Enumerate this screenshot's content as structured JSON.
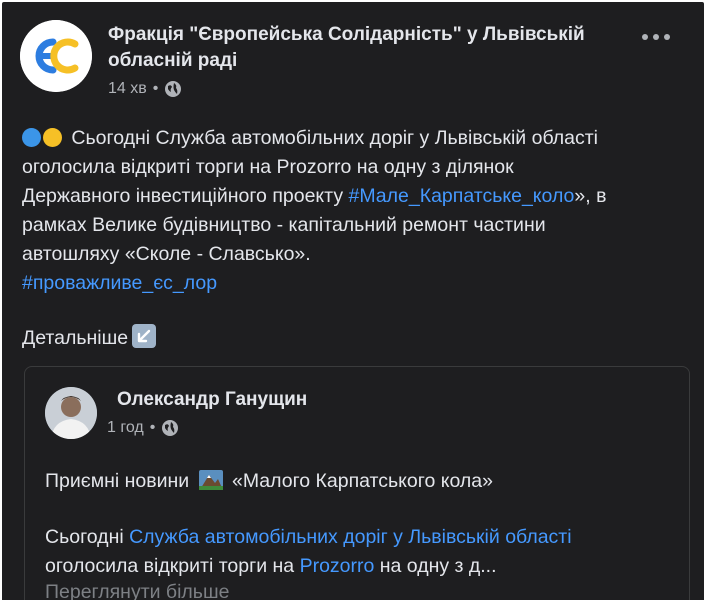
{
  "post": {
    "author": "Фракція \"Європейська Солідарність\" у Львівській обласній раді",
    "time": "14 хв",
    "separator": "•",
    "privacy_icon": "globe-icon",
    "more_icon": "more-options-icon",
    "logo_text": "ЄС",
    "text_line1": " Сьогодні Служба автомобільних доріг у Львівській області",
    "text_line2": "оголосила відкриті торги на Prozorro на одну з ділянок",
    "text_line3_a": "Державного інвестиційного проекту ",
    "hashtag_1": "#Мале_Карпатське_коло",
    "text_line3_b": "», в",
    "text_line4": "рамках Велике будівництво  - капітальний ремонт частини",
    "text_line5": "автошляху «Сколе - Славсько».",
    "hashtag_2": "#проважливе_єс_лор",
    "details_label": "Детальніше",
    "details_icon": "arrow-down-left-icon"
  },
  "shared": {
    "author": "Олександр Ганущин",
    "time": "1 год",
    "separator": "•",
    "line1_a": "Приємні новини ",
    "line1_b": " «Малого Карпатського кола»",
    "para_a": "Сьогодні ",
    "link_1": "Служба автомобільних доріг у Львівській області",
    "para_b": "оголосила відкриті торги на ",
    "link_2": "Prozorro",
    "para_c": " на одну з д...",
    "see_more": "Переглянути більше"
  },
  "colors": {
    "background": "#1e1e20",
    "text": "#e4e6eb",
    "secondary": "#b0b3b8",
    "link": "#4599ff",
    "logo_blue": "#2d7de0",
    "logo_yellow": "#f6c026"
  }
}
